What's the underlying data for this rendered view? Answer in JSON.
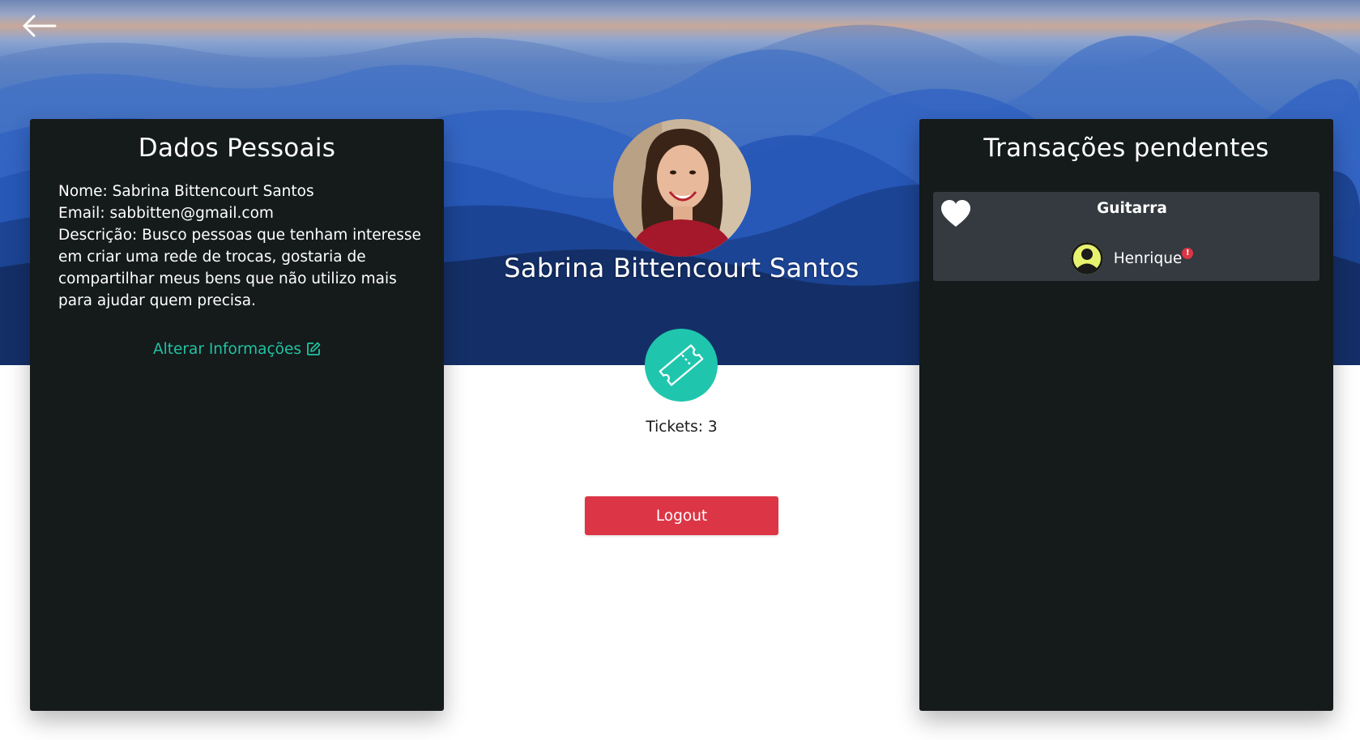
{
  "personal": {
    "title": "Dados Pessoais",
    "name_line": "Nome: Sabrina Bittencourt Santos",
    "email_line": "Email: sabbitten@gmail.com",
    "description_line": "Descrição: Busco pessoas que tenham interesse em criar uma rede de trocas, gostaria de compartilhar meus bens que não utilizo mais para ajudar quem precisa.",
    "edit_label": "Alterar Informações"
  },
  "profile": {
    "name": "Sabrina Bittencourt Santos",
    "tickets_label": "Tickets: 3",
    "logout_label": "Logout"
  },
  "transactions": {
    "title": "Transações pendentes",
    "items": [
      {
        "item": "Guitarra",
        "user": "Henrique",
        "alert": "!"
      }
    ]
  },
  "colors": {
    "accent": "#1fc6ad",
    "danger": "#dc3545",
    "panel": "#151a1b",
    "card": "#343a40",
    "user_icon": "#e7f36e"
  },
  "icons": [
    "back-arrow-icon",
    "edit-icon",
    "ticket-icon",
    "heart-icon",
    "user-icon",
    "alert-icon"
  ]
}
